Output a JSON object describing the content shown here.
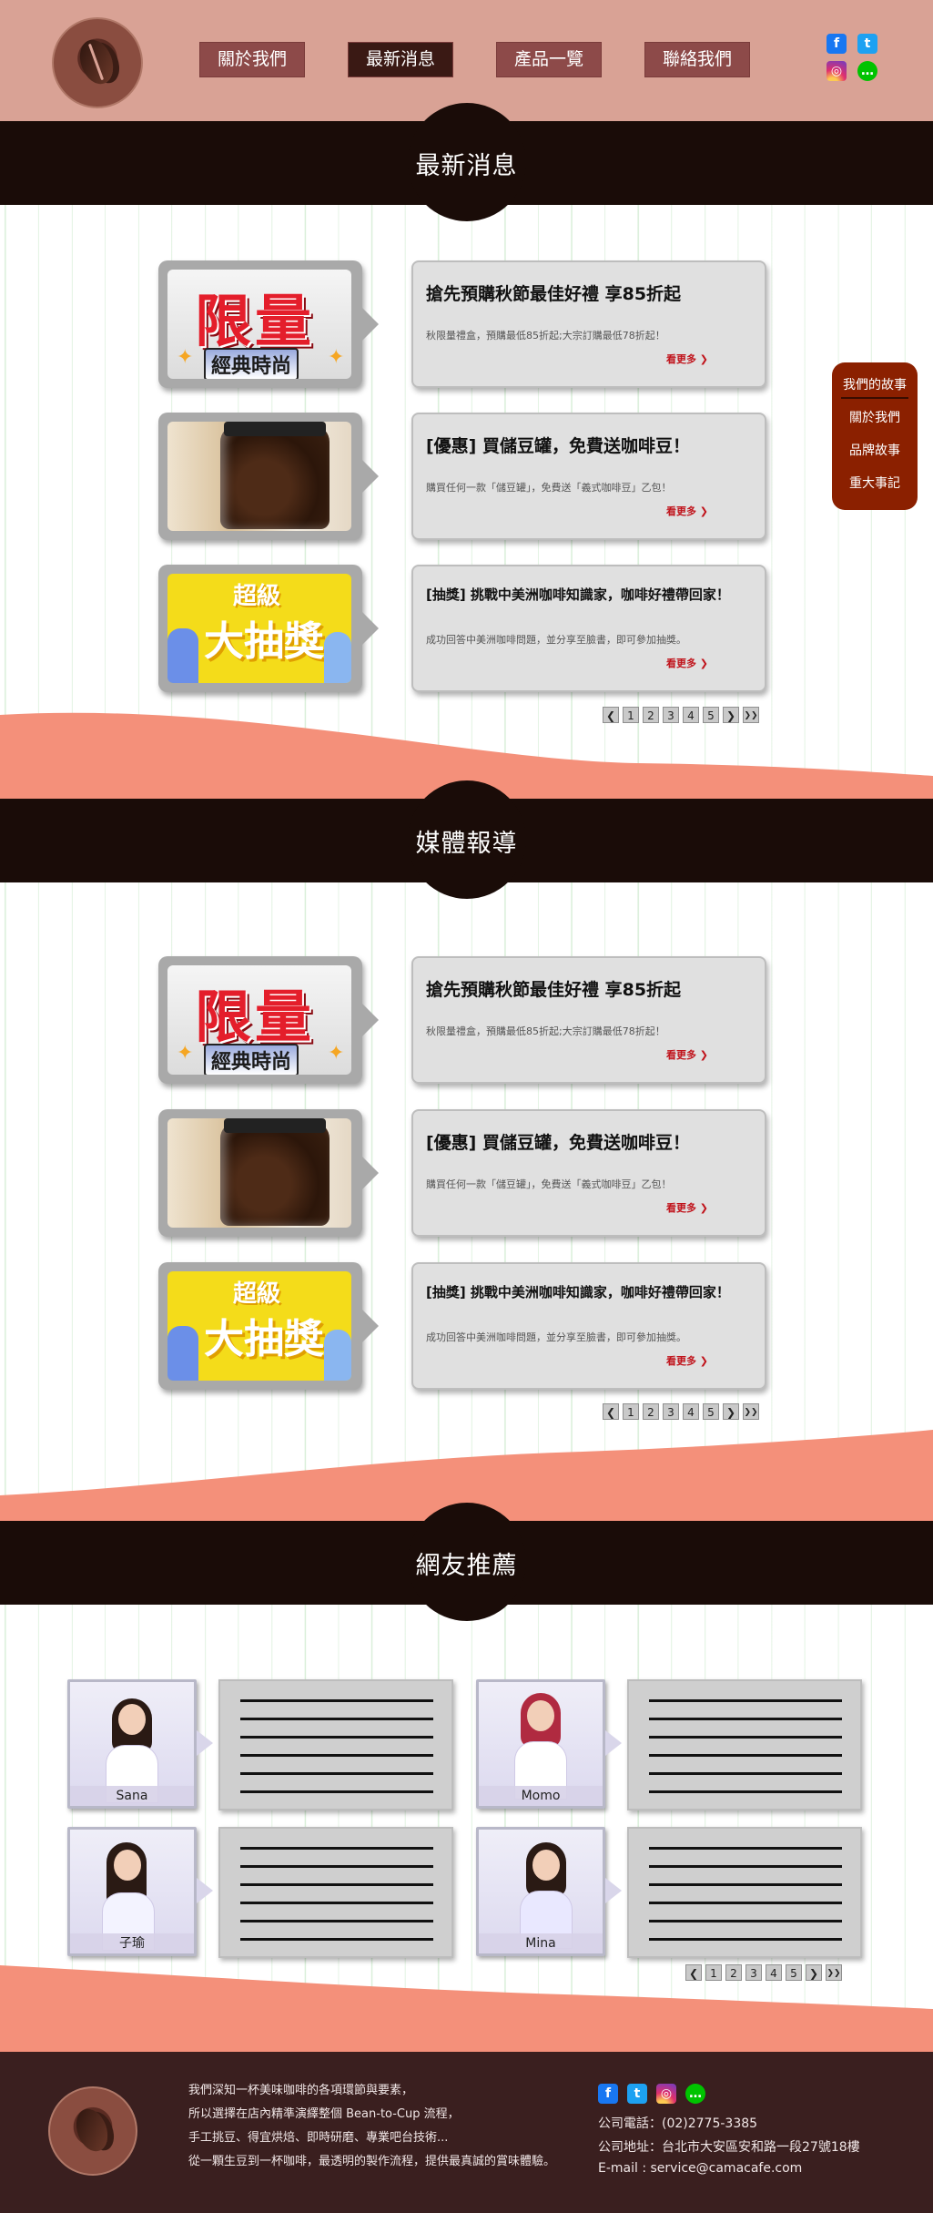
{
  "nav": {
    "items": [
      "關於我們",
      "最新消息",
      "產品一覽",
      "聯絡我們"
    ],
    "active_index": 1
  },
  "social_icons": [
    "facebook-icon",
    "twitter-icon",
    "instagram-icon",
    "line-icon"
  ],
  "sections": {
    "news_title": "最新消息",
    "media_title": "媒體報導",
    "reviews_title": "網友推薦"
  },
  "side_menu": {
    "items": [
      "我們的故事",
      "關於我們",
      "品牌故事",
      "重大事記"
    ]
  },
  "news": [
    {
      "title": "搶先預購秋節最佳好禮 享85折起",
      "desc": "秋限量禮盒，預購最低85折起;大宗訂購最低78折起！",
      "more": "看更多 ❯",
      "thumb": "limited",
      "thumb_line1": "限量",
      "thumb_line2": "經典時尚"
    },
    {
      "title": "[優惠] 買儲豆罐，免費送咖啡豆！",
      "desc": "購買任何一款「儲豆罐」，免費送「義式咖啡豆」乙包！",
      "more": "看更多 ❯",
      "thumb": "jar"
    },
    {
      "title": "[抽獎] 挑戰中美洲咖啡知識家，咖啡好禮帶回家！",
      "desc": "成功回答中美洲咖啡問題，並分享至臉書，即可參加抽獎。",
      "more": "看更多 ❯",
      "thumb": "lottery",
      "thumb_line1": "超級",
      "thumb_line2": "大抽獎"
    }
  ],
  "media": [
    {
      "title": "搶先預購秋節最佳好禮 享85折起",
      "desc": "秋限量禮盒，預購最低85折起;大宗訂購最低78折起！",
      "more": "看更多 ❯",
      "thumb": "limited",
      "thumb_line1": "限量",
      "thumb_line2": "經典時尚"
    },
    {
      "title": "[優惠] 買儲豆罐，免費送咖啡豆！",
      "desc": "購買任何一款「儲豆罐」，免費送「義式咖啡豆」乙包！",
      "more": "看更多 ❯",
      "thumb": "jar"
    },
    {
      "title": "[抽獎] 挑戰中美洲咖啡知識家，咖啡好禮帶回家！",
      "desc": "成功回答中美洲咖啡問題，並分享至臉書，即可參加抽獎。",
      "more": "看更多 ❯",
      "thumb": "lottery",
      "thumb_line1": "超級",
      "thumb_line2": "大抽獎"
    }
  ],
  "pager": {
    "prev": "❮",
    "pages": [
      "1",
      "2",
      "3",
      "4",
      "5"
    ],
    "next": "❯",
    "last": "❯❯"
  },
  "reviews": [
    {
      "name": "Sana"
    },
    {
      "name": "Momo"
    },
    {
      "name": "子瑜"
    },
    {
      "name": "Mina"
    }
  ],
  "footer": {
    "about_lines": [
      "我們深知一杯美味咖啡的各項環節與要素，",
      "所以選擇在店內精準演繹整個 Bean-to-Cup 流程，",
      "手工挑豆、得宜烘焙、即時研磨、專業吧台技術...",
      "從一顆生豆到一杯咖啡，最透明的製作流程，提供最真誠的賞味體驗。"
    ],
    "phone": "公司電話：(02)2775-3385",
    "address": "公司地址：台北市大安區安和路一段27號18樓",
    "email": "E-mail : service@camacafe.com"
  },
  "colors": {
    "header_bg": "#d9a295",
    "nav_button": "#8d4a49",
    "nav_active": "#3a1914",
    "section_bar": "#1a0c08",
    "wave": "#f4907a",
    "side_menu": "#8b2000",
    "footer_bg": "#3a1f1f",
    "more_link": "#c0131b"
  }
}
